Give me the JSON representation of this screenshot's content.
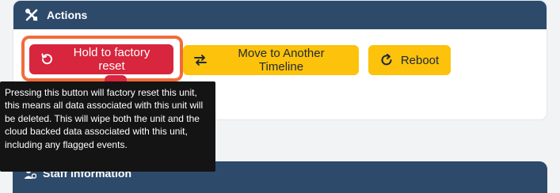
{
  "actions_panel": {
    "title": "Actions",
    "icon": "tools-icon",
    "buttons": {
      "factory_reset": {
        "label": "Hold to factory reset",
        "icon": "reset-icon",
        "color": "#d7263d"
      },
      "move_timeline": {
        "label": "Move to Another Timeline",
        "icon": "swap-arrows-icon",
        "color": "#fcc20c"
      },
      "reboot": {
        "label": "Reboot",
        "icon": "reboot-icon",
        "color": "#fcc20c"
      }
    }
  },
  "tooltip": {
    "text": "Pressing this button will factory reset this unit, this means all data associated with this unit will be deleted. This will wipe both the unit and the cloud backed data associated with this unit, including any flagged events."
  },
  "staff_panel": {
    "title": "Staff information",
    "icon": "staff-icon"
  },
  "colors": {
    "header": "#2d4a6b",
    "highlight": "#f26b3a"
  }
}
